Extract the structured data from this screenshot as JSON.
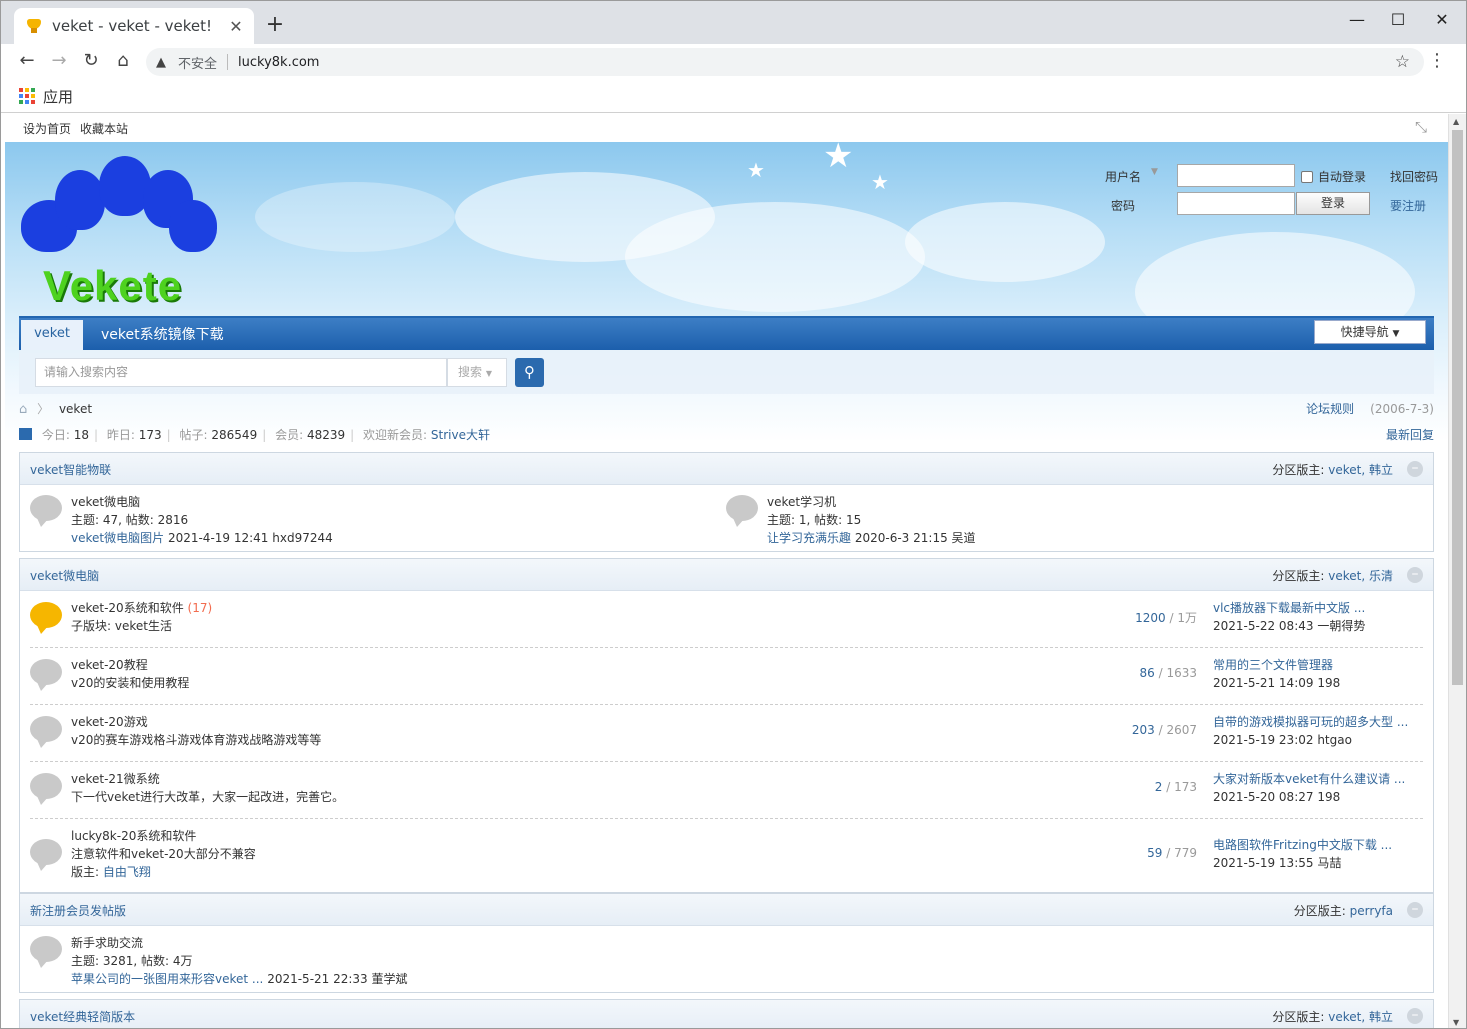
{
  "browser": {
    "tab_title": "veket - veket - veket!",
    "close": "✕",
    "new_tab": "+",
    "minimize": "—",
    "maximize": "☐",
    "win_close": "✕",
    "insecure": "不安全",
    "url": "lucky8k.com",
    "bookmarks_apps": "应用"
  },
  "site": {
    "top_links": [
      "设为首页",
      "收藏本站"
    ],
    "logo_text": "Vekete",
    "login": {
      "username_label": "用户名",
      "auto_login": "自动登录",
      "forgot": "找回密码",
      "password_label": "密码",
      "login_btn": "登录",
      "register": "要注册"
    },
    "nav": {
      "current": "veket",
      "items": [
        "veket系统镜像下载"
      ],
      "quick_nav": "快捷导航"
    },
    "search": {
      "placeholder": "请输入搜索内容",
      "select": "搜索"
    },
    "breadcrumb": {
      "current": "veket",
      "rules": "论坛规则",
      "date": "(2006-7-3)"
    },
    "stats": {
      "today_label": "今日:",
      "today": "18",
      "yesterday_label": "昨日:",
      "yesterday": "173",
      "posts_label": "帖子:",
      "posts": "286549",
      "members_label": "会员:",
      "members": "48239",
      "newest_label": "欢迎新会员:",
      "newest": "Strive大轩",
      "latest": "最新回复"
    },
    "sections": [
      {
        "title": "veket智能物联",
        "mod_label": "分区版主:",
        "mods": "veket, 韩立",
        "forums": [
          {
            "name": "veket微电脑",
            "info": "主题: 47, 帖数: 2816",
            "last_link": "veket微电脑图片",
            "last_meta": "2021-4-19 12:41 hxd97244"
          },
          {
            "name": "veket学习机",
            "info": "主题: 1, 帖数: 15",
            "last_link": "让学习充满乐趣",
            "last_meta": "2020-6-3 21:15 吴道"
          }
        ]
      },
      {
        "title": "veket微电脑",
        "mod_label": "分区版主:",
        "mods": "veket, 乐清",
        "forums": [
          {
            "name": "veket-20系统和软件",
            "new": "(17)",
            "desc": "子版块: veket生活",
            "threads": "1200",
            "posts": "1万",
            "last_title": "vlc播放器下载最新中文版 ...",
            "last_meta": "2021-5-22 08:43 一朝得势"
          },
          {
            "name": "veket-20教程",
            "desc": "v20的安装和使用教程",
            "threads": "86",
            "posts": "1633",
            "last_title": "常用的三个文件管理器",
            "last_meta": "2021-5-21 14:09 198"
          },
          {
            "name": "veket-20游戏",
            "desc": "v20的赛车游戏格斗游戏体育游戏战略游戏等等",
            "threads": "203",
            "posts": "2607",
            "last_title": "自带的游戏模拟器可玩的超多大型 ...",
            "last_meta": "2021-5-19 23:02 htgao"
          },
          {
            "name": "veket-21微系统",
            "desc": "下一代veket进行大改革，大家一起改进，完善它。",
            "threads": "2",
            "posts": "173",
            "last_title": "大家对新版本veket有什么建议请 ...",
            "last_meta": "2021-5-20 08:27 198"
          },
          {
            "name": "lucky8k-20系统和软件",
            "desc": "注意软件和veket-20大部分不兼容",
            "mod_label": "版主:",
            "mod": "自由飞翔",
            "threads": "59",
            "posts": "779",
            "last_title": "电路图软件Fritzing中文版下载 ...",
            "last_meta": "2021-5-19 13:55 马喆"
          }
        ]
      },
      {
        "title": "新注册会员发帖版",
        "mod_label": "分区版主:",
        "mods": "perryfa",
        "forums": [
          {
            "name": "新手求助交流",
            "info": "主题: 3281, 帖数: 4万",
            "last_link": "苹果公司的一张图用来形容veket ...",
            "last_meta": "2021-5-21 22:33 董学斌"
          }
        ]
      },
      {
        "title": "veket经典轻简版本",
        "mod_label": "分区版主:",
        "mods": "veket, 韩立"
      }
    ]
  },
  "colors": {
    "link": "#336699",
    "nav": "#2266b0",
    "new": "#f26c4f"
  }
}
